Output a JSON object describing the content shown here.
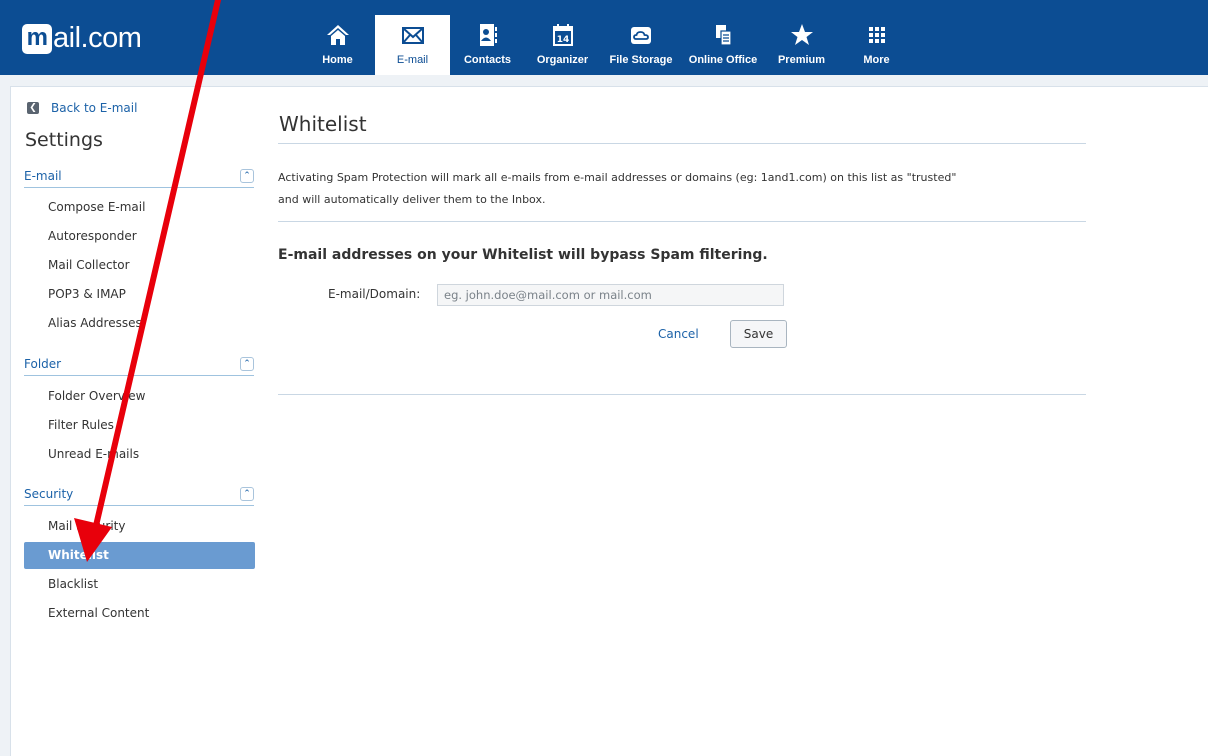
{
  "header": {
    "logo_text": "mail.com",
    "logo_initial": "m",
    "logo_rest": "ail.com",
    "nav": [
      {
        "label": "Home",
        "icon": "home-icon"
      },
      {
        "label": "E-mail",
        "icon": "envelope-icon",
        "active": true
      },
      {
        "label": "Contacts",
        "icon": "contacts-icon"
      },
      {
        "label": "Organizer",
        "icon": "calendar-icon",
        "icon_text": "14"
      },
      {
        "label": "File Storage",
        "icon": "cloud-icon"
      },
      {
        "label": "Online Office",
        "icon": "documents-icon"
      },
      {
        "label": "Premium",
        "icon": "star-icon"
      },
      {
        "label": "More",
        "icon": "grid-icon"
      }
    ]
  },
  "sidebar": {
    "back_label": "Back to E-mail",
    "title": "Settings",
    "sections": [
      {
        "title": "E-mail",
        "items": [
          "Compose E-mail",
          "Autoresponder",
          "Mail Collector",
          "POP3 & IMAP",
          "Alias Addresses"
        ]
      },
      {
        "title": "Folder",
        "items": [
          "Folder Overview",
          "Filter Rules",
          "Unread E-mails"
        ]
      },
      {
        "title": "Security",
        "items": [
          "Mail Security",
          "Whitelist",
          "Blacklist",
          "External Content"
        ],
        "active_item": "Whitelist"
      }
    ]
  },
  "main": {
    "title": "Whitelist",
    "description_line1": "Activating Spam Protection will mark all e-mails from e-mail addresses or domains (eg: 1and1.com) on this list as \"trusted\"",
    "description_line2": "and will automatically deliver them to the Inbox.",
    "bypass_heading": "E-mail addresses on your Whitelist will bypass Spam filtering.",
    "field_label": "E-mail/Domain:",
    "field_value": "",
    "field_placeholder": "eg. john.doe@mail.com or mail.com",
    "cancel_label": "Cancel",
    "save_label": "Save"
  },
  "colors": {
    "header_bg": "#0c4d93",
    "link": "#1c62a8",
    "active_item_bg": "#6a9bd1",
    "annotation_arrow": "#e8000b"
  }
}
